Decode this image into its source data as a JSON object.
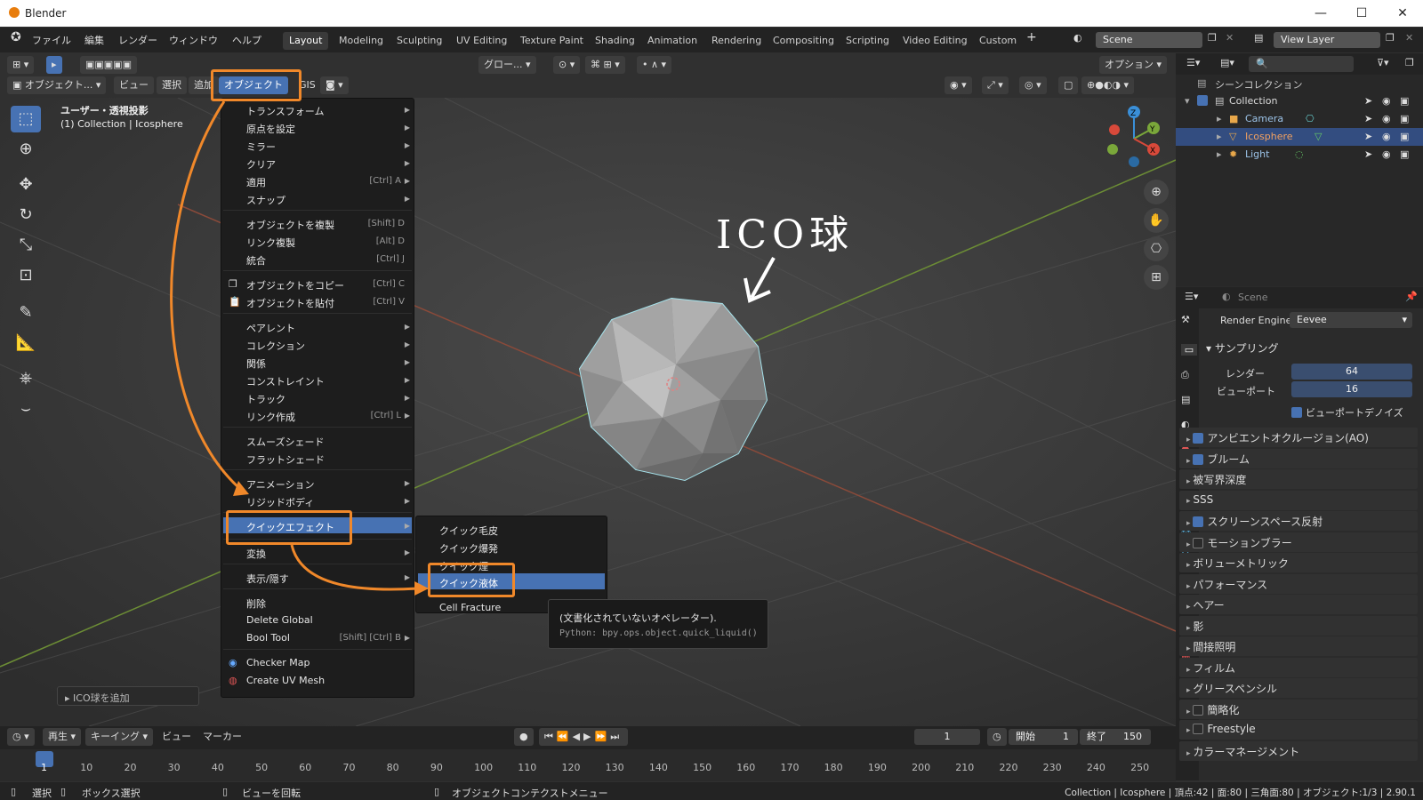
{
  "app": {
    "title": "Blender"
  },
  "menubar": {
    "items": [
      "ファイル",
      "編集",
      "レンダー",
      "ウィンドウ",
      "ヘルプ"
    ]
  },
  "workspace_tabs": [
    "Layout",
    "Modeling",
    "Sculpting",
    "UV Editing",
    "Texture Paint",
    "Shading",
    "Animation",
    "Rendering",
    "Compositing",
    "Scripting",
    "Video Editing",
    "Custom"
  ],
  "scene": {
    "name": "Scene",
    "view_layer": "View Layer"
  },
  "header3d": {
    "mode": "オブジェクト...",
    "menus": [
      "ビュー",
      "選択",
      "追加",
      "オブジェクト"
    ],
    "gis": "GIS",
    "transform": "グロー...",
    "options": "オプション"
  },
  "viewport": {
    "view_name": "ユーザー・透視投影",
    "context": "(1) Collection | Icosphere",
    "annotation": "ICO球",
    "last_op": "ICO球を追加"
  },
  "object_menu": {
    "items": [
      {
        "label": "トランスフォーム",
        "shortcut": "",
        "sub": true
      },
      {
        "label": "原点を設定",
        "shortcut": "",
        "sub": true
      },
      {
        "label": "ミラー",
        "shortcut": "",
        "sub": true
      },
      {
        "label": "クリア",
        "shortcut": "",
        "sub": true
      },
      {
        "label": "適用",
        "shortcut": "[Ctrl] A",
        "sub": true
      },
      {
        "label": "スナップ",
        "shortcut": "",
        "sub": true
      },
      {
        "label": "オブジェクトを複製",
        "shortcut": "[Shift] D",
        "sub": false
      },
      {
        "label": "リンク複製",
        "shortcut": "[Alt] D",
        "sub": false
      },
      {
        "label": "統合",
        "shortcut": "[Ctrl] J",
        "sub": false
      },
      {
        "label": "オブジェクトをコピー",
        "shortcut": "[Ctrl] C",
        "sub": false
      },
      {
        "label": "オブジェクトを貼付",
        "shortcut": "[Ctrl] V",
        "sub": false
      },
      {
        "label": "ペアレント",
        "shortcut": "",
        "sub": true
      },
      {
        "label": "コレクション",
        "shortcut": "",
        "sub": true
      },
      {
        "label": "関係",
        "shortcut": "",
        "sub": true
      },
      {
        "label": "コンストレイント",
        "shortcut": "",
        "sub": true
      },
      {
        "label": "トラック",
        "shortcut": "",
        "sub": true
      },
      {
        "label": "リンク作成",
        "shortcut": "[Ctrl] L",
        "sub": true
      },
      {
        "label": "スムーズシェード",
        "shortcut": "",
        "sub": false
      },
      {
        "label": "フラットシェード",
        "shortcut": "",
        "sub": false
      },
      {
        "label": "アニメーション",
        "shortcut": "",
        "sub": true
      },
      {
        "label": "リジッドボディ",
        "shortcut": "",
        "sub": true
      },
      {
        "label": "クイックエフェクト",
        "shortcut": "",
        "sub": true
      },
      {
        "label": "変換",
        "shortcut": "",
        "sub": true
      },
      {
        "label": "表示/隠す",
        "shortcut": "",
        "sub": true
      },
      {
        "label": "削除",
        "shortcut": "",
        "sub": false
      },
      {
        "label": "Delete Global",
        "shortcut": "",
        "sub": false
      },
      {
        "label": "Bool Tool",
        "shortcut": "[Shift] [Ctrl] B",
        "sub": true
      },
      {
        "label": "Checker Map",
        "shortcut": "",
        "sub": false
      },
      {
        "label": "Create UV Mesh",
        "shortcut": "",
        "sub": false
      }
    ]
  },
  "quick_effects": {
    "items": [
      "クイック毛皮",
      "クイック爆発",
      "クイック煙",
      "クイック液体",
      "Cell Fracture"
    ]
  },
  "tooltip": {
    "line1": "(文書化されていないオペレーター).",
    "line2": "Python: bpy.ops.object.quick_liquid()"
  },
  "outliner": {
    "root": "シーンコレクション",
    "collection": "Collection",
    "objects": [
      "Camera",
      "Icosphere",
      "Light"
    ]
  },
  "properties": {
    "tab": "Scene",
    "render_engine_label": "Render Engine",
    "render_engine": "Eevee",
    "sampling": "サンプリング",
    "render_label": "レンダー",
    "render_value": "64",
    "viewport_label": "ビューポート",
    "viewport_value": "16",
    "denoise": "ビューポートデノイズ",
    "sections": [
      {
        "label": "アンビエントオクルージョン(AO)",
        "check": true
      },
      {
        "label": "ブルーム",
        "check": true
      },
      {
        "label": "被写界深度",
        "check": null
      },
      {
        "label": "SSS",
        "check": null
      },
      {
        "label": "スクリーンスペース反射",
        "check": true
      },
      {
        "label": "モーションブラー",
        "check": false
      },
      {
        "label": "ボリューメトリック",
        "check": null
      },
      {
        "label": "パフォーマンス",
        "check": null
      },
      {
        "label": "ヘアー",
        "check": null
      },
      {
        "label": "影",
        "check": null
      },
      {
        "label": "間接照明",
        "check": null
      },
      {
        "label": "フィルム",
        "check": null
      },
      {
        "label": "グリースペンシル",
        "check": null
      },
      {
        "label": "簡略化",
        "check": false
      },
      {
        "label": "Freestyle",
        "check": false
      },
      {
        "label": "カラーマネージメント",
        "check": null
      }
    ]
  },
  "timeline": {
    "menus": [
      "再生",
      "キーイング",
      "ビュー",
      "マーカー"
    ],
    "current_frame": "1",
    "start_label": "開始",
    "start": "1",
    "end_label": "終了",
    "end": "150",
    "ticks": [
      "1",
      "10",
      "20",
      "30",
      "40",
      "50",
      "60",
      "70",
      "80",
      "90",
      "100",
      "110",
      "120",
      "130",
      "140",
      "150",
      "160",
      "170",
      "180",
      "190",
      "200",
      "210",
      "220",
      "230",
      "240",
      "250"
    ]
  },
  "statusbar": {
    "select": "選択",
    "box_select": "ボックス選択",
    "rotate": "ビューを回転",
    "context_menu": "オブジェクトコンテクストメニュー",
    "stats": "Collection | Icosphere | 頂点:42 | 面:80 | 三角面:80 | オブジェクト:1/3 | 2.90.1"
  },
  "colors": {
    "accent": "#4772b3",
    "annotation": "#f0882a",
    "selected_outline": "#a6e3ec"
  }
}
